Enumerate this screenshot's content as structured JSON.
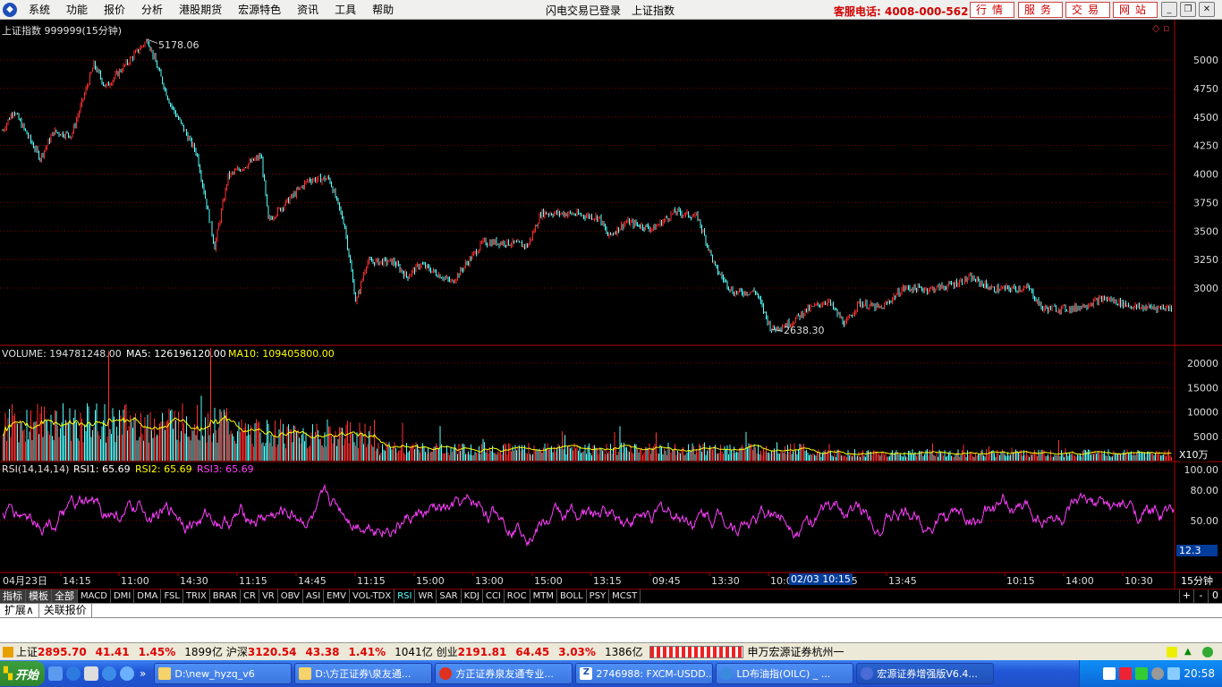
{
  "menubar": {
    "items": [
      "系统",
      "功能",
      "报价",
      "分析",
      "港股期货",
      "宏源特色",
      "资讯",
      "工具",
      "帮助"
    ],
    "login_status": "闪电交易已登录",
    "current_symbol": "上证指数",
    "hotline": "客服电话: 4008-000-562",
    "buttons": [
      "行情",
      "服务",
      "交易",
      "网站"
    ]
  },
  "chart_header": {
    "title": "上证指数 999999(15分钟)",
    "high_label": "5178.06",
    "low_label": "2638.30"
  },
  "price_axis": [
    "5000",
    "4750",
    "4500",
    "4250",
    "4000",
    "3750",
    "3500",
    "3250",
    "3000"
  ],
  "volume_header": {
    "volume": "VOLUME: 194781248.00",
    "ma5": "MA5: 126196120.00",
    "ma10": "MA10: 109405800.00"
  },
  "volume_axis": [
    "20000",
    "15000",
    "10000",
    "5000"
  ],
  "volume_unit": "X10万",
  "rsi_header": {
    "name": "RSI(14,14,14)",
    "rsi1": "RSI1: 65.69",
    "rsi2": "RSI2: 65.69",
    "rsi3": "RSI3: 65.69"
  },
  "rsi_axis": [
    "100.00",
    "80.00",
    "50.00"
  ],
  "rsi_current": "12.3",
  "time_axis": [
    "04月23日",
    "14:15",
    "11:00",
    "14:30",
    "11:15",
    "14:45",
    "11:15",
    "15:00",
    "13:00",
    "15:00",
    "13:15",
    "09:45",
    "13:30",
    "10:00",
    "10:15",
    "13:45",
    "10:15",
    "14:00",
    "10:30"
  ],
  "cursor_time": "02/03 10:15",
  "period": "15分钟",
  "indicator_bar": {
    "tabs": [
      "指标",
      "模板",
      "全部"
    ],
    "items": [
      "MACD",
      "DMI",
      "DMA",
      "FSL",
      "TRIX",
      "BRAR",
      "CR",
      "VR",
      "OBV",
      "ASI",
      "EMV",
      "VOL-TDX",
      "RSI",
      "WR",
      "SAR",
      "KDJ",
      "CCI",
      "ROC",
      "MTM",
      "BOLL",
      "PSY",
      "MCST"
    ],
    "active": "RSI",
    "right_buttons": [
      "+",
      "-",
      "0"
    ]
  },
  "ext_bar": [
    "扩展∧",
    "关联报价"
  ],
  "status_bar": {
    "sh_label": "上证",
    "sh_value": "2895.70",
    "sh_change": "41.41",
    "sh_pct": "1.45%",
    "sh_amount": "1899亿",
    "hs_label": "沪深",
    "hs_value": "3120.54",
    "hs_change": "43.38",
    "hs_pct": "1.41%",
    "hs_amount": "1041亿",
    "cy_label": "创业",
    "cy_value": "2191.81",
    "cy_change": "64.45",
    "cy_pct": "3.03%",
    "cy_amount": "1386亿",
    "broker": "申万宏源证券杭州一"
  },
  "taskbar": {
    "start": "开始",
    "tasks": [
      "D:\\new_hyzq_v6",
      "D:\\方正证券\\泉友通...",
      "方正证券泉友通专业...",
      "2746988: FXCM-USDD...",
      "LD布油指(OILC) _ ...",
      "宏源证券增强版V6.4..."
    ],
    "clock": "20:58"
  },
  "colors": {
    "up": "#ff3030",
    "down": "#54ffff",
    "rsi": "#ff40ff",
    "ma5": "#ffffff",
    "ma10": "#ffff00",
    "grid": "#8a0000"
  }
}
